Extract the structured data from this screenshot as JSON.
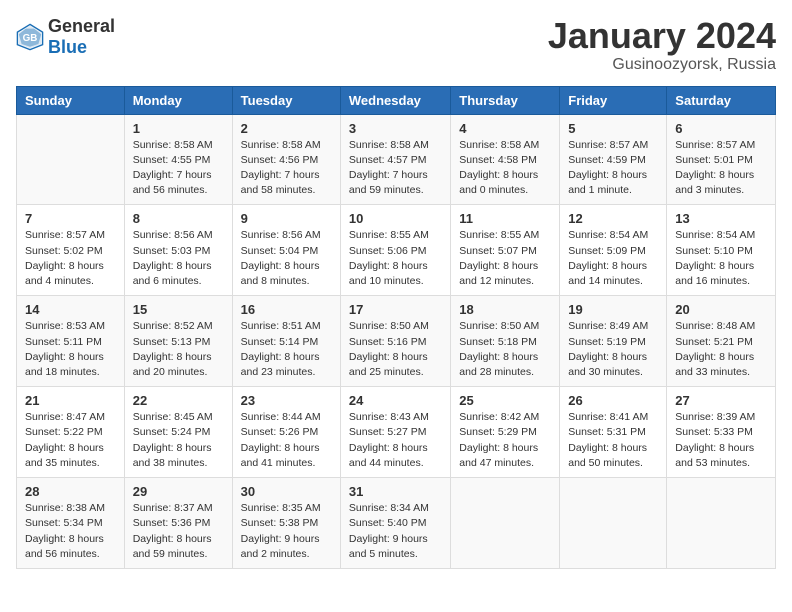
{
  "header": {
    "logo_general": "General",
    "logo_blue": "Blue",
    "month": "January 2024",
    "location": "Gusinoozyorsk, Russia"
  },
  "days_of_week": [
    "Sunday",
    "Monday",
    "Tuesday",
    "Wednesday",
    "Thursday",
    "Friday",
    "Saturday"
  ],
  "weeks": [
    [
      {
        "day": "",
        "details": ""
      },
      {
        "day": "1",
        "details": "Sunrise: 8:58 AM\nSunset: 4:55 PM\nDaylight: 7 hours\nand 56 minutes."
      },
      {
        "day": "2",
        "details": "Sunrise: 8:58 AM\nSunset: 4:56 PM\nDaylight: 7 hours\nand 58 minutes."
      },
      {
        "day": "3",
        "details": "Sunrise: 8:58 AM\nSunset: 4:57 PM\nDaylight: 7 hours\nand 59 minutes."
      },
      {
        "day": "4",
        "details": "Sunrise: 8:58 AM\nSunset: 4:58 PM\nDaylight: 8 hours\nand 0 minutes."
      },
      {
        "day": "5",
        "details": "Sunrise: 8:57 AM\nSunset: 4:59 PM\nDaylight: 8 hours\nand 1 minute."
      },
      {
        "day": "6",
        "details": "Sunrise: 8:57 AM\nSunset: 5:01 PM\nDaylight: 8 hours\nand 3 minutes."
      }
    ],
    [
      {
        "day": "7",
        "details": "Sunrise: 8:57 AM\nSunset: 5:02 PM\nDaylight: 8 hours\nand 4 minutes."
      },
      {
        "day": "8",
        "details": "Sunrise: 8:56 AM\nSunset: 5:03 PM\nDaylight: 8 hours\nand 6 minutes."
      },
      {
        "day": "9",
        "details": "Sunrise: 8:56 AM\nSunset: 5:04 PM\nDaylight: 8 hours\nand 8 minutes."
      },
      {
        "day": "10",
        "details": "Sunrise: 8:55 AM\nSunset: 5:06 PM\nDaylight: 8 hours\nand 10 minutes."
      },
      {
        "day": "11",
        "details": "Sunrise: 8:55 AM\nSunset: 5:07 PM\nDaylight: 8 hours\nand 12 minutes."
      },
      {
        "day": "12",
        "details": "Sunrise: 8:54 AM\nSunset: 5:09 PM\nDaylight: 8 hours\nand 14 minutes."
      },
      {
        "day": "13",
        "details": "Sunrise: 8:54 AM\nSunset: 5:10 PM\nDaylight: 8 hours\nand 16 minutes."
      }
    ],
    [
      {
        "day": "14",
        "details": "Sunrise: 8:53 AM\nSunset: 5:11 PM\nDaylight: 8 hours\nand 18 minutes."
      },
      {
        "day": "15",
        "details": "Sunrise: 8:52 AM\nSunset: 5:13 PM\nDaylight: 8 hours\nand 20 minutes."
      },
      {
        "day": "16",
        "details": "Sunrise: 8:51 AM\nSunset: 5:14 PM\nDaylight: 8 hours\nand 23 minutes."
      },
      {
        "day": "17",
        "details": "Sunrise: 8:50 AM\nSunset: 5:16 PM\nDaylight: 8 hours\nand 25 minutes."
      },
      {
        "day": "18",
        "details": "Sunrise: 8:50 AM\nSunset: 5:18 PM\nDaylight: 8 hours\nand 28 minutes."
      },
      {
        "day": "19",
        "details": "Sunrise: 8:49 AM\nSunset: 5:19 PM\nDaylight: 8 hours\nand 30 minutes."
      },
      {
        "day": "20",
        "details": "Sunrise: 8:48 AM\nSunset: 5:21 PM\nDaylight: 8 hours\nand 33 minutes."
      }
    ],
    [
      {
        "day": "21",
        "details": "Sunrise: 8:47 AM\nSunset: 5:22 PM\nDaylight: 8 hours\nand 35 minutes."
      },
      {
        "day": "22",
        "details": "Sunrise: 8:45 AM\nSunset: 5:24 PM\nDaylight: 8 hours\nand 38 minutes."
      },
      {
        "day": "23",
        "details": "Sunrise: 8:44 AM\nSunset: 5:26 PM\nDaylight: 8 hours\nand 41 minutes."
      },
      {
        "day": "24",
        "details": "Sunrise: 8:43 AM\nSunset: 5:27 PM\nDaylight: 8 hours\nand 44 minutes."
      },
      {
        "day": "25",
        "details": "Sunrise: 8:42 AM\nSunset: 5:29 PM\nDaylight: 8 hours\nand 47 minutes."
      },
      {
        "day": "26",
        "details": "Sunrise: 8:41 AM\nSunset: 5:31 PM\nDaylight: 8 hours\nand 50 minutes."
      },
      {
        "day": "27",
        "details": "Sunrise: 8:39 AM\nSunset: 5:33 PM\nDaylight: 8 hours\nand 53 minutes."
      }
    ],
    [
      {
        "day": "28",
        "details": "Sunrise: 8:38 AM\nSunset: 5:34 PM\nDaylight: 8 hours\nand 56 minutes."
      },
      {
        "day": "29",
        "details": "Sunrise: 8:37 AM\nSunset: 5:36 PM\nDaylight: 8 hours\nand 59 minutes."
      },
      {
        "day": "30",
        "details": "Sunrise: 8:35 AM\nSunset: 5:38 PM\nDaylight: 9 hours\nand 2 minutes."
      },
      {
        "day": "31",
        "details": "Sunrise: 8:34 AM\nSunset: 5:40 PM\nDaylight: 9 hours\nand 5 minutes."
      },
      {
        "day": "",
        "details": ""
      },
      {
        "day": "",
        "details": ""
      },
      {
        "day": "",
        "details": ""
      }
    ]
  ]
}
